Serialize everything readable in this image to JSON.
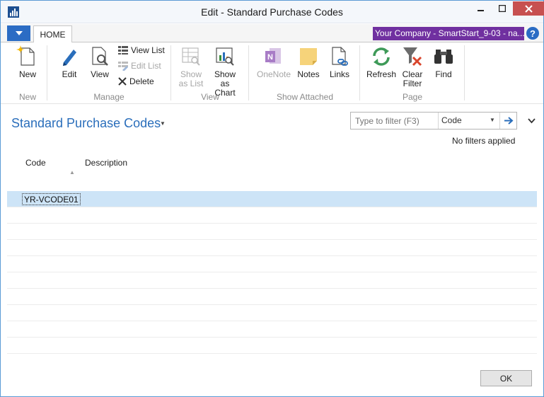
{
  "window": {
    "title": "Edit - Standard Purchase Codes"
  },
  "tabs": {
    "home": "HOME"
  },
  "company": "Your Company - SmartStart_9-03 - na...",
  "help": "?",
  "ribbon": {
    "new": {
      "label": "New",
      "group": "New"
    },
    "manage": {
      "group": "Manage",
      "edit": "Edit",
      "view": "View",
      "view_list": "View List",
      "edit_list": "Edit List",
      "delete": "Delete"
    },
    "view": {
      "group": "View",
      "show_as_list_1": "Show",
      "show_as_list_2": "as List",
      "show_as_chart_1": "Show as",
      "show_as_chart_2": "Chart"
    },
    "show_attached": {
      "group": "Show Attached",
      "onenote": "OneNote",
      "notes": "Notes",
      "links": "Links"
    },
    "page": {
      "group": "Page",
      "refresh": "Refresh",
      "clear_filter_1": "Clear",
      "clear_filter_2": "Filter",
      "find": "Find"
    }
  },
  "page": {
    "title": "Standard Purchase Codes"
  },
  "filter": {
    "placeholder": "Type to filter (F3)",
    "field": "Code",
    "status": "No filters applied"
  },
  "table": {
    "columns": [
      "Code",
      "Description"
    ],
    "rows": [
      {
        "code": "YR-VCODE01",
        "description": ""
      }
    ]
  },
  "footer": {
    "ok": "OK"
  },
  "colors": {
    "accent": "#2a6ebb",
    "company_bg": "#7030a0",
    "selected_row": "#cde4f7",
    "close_button": "#c75050"
  }
}
